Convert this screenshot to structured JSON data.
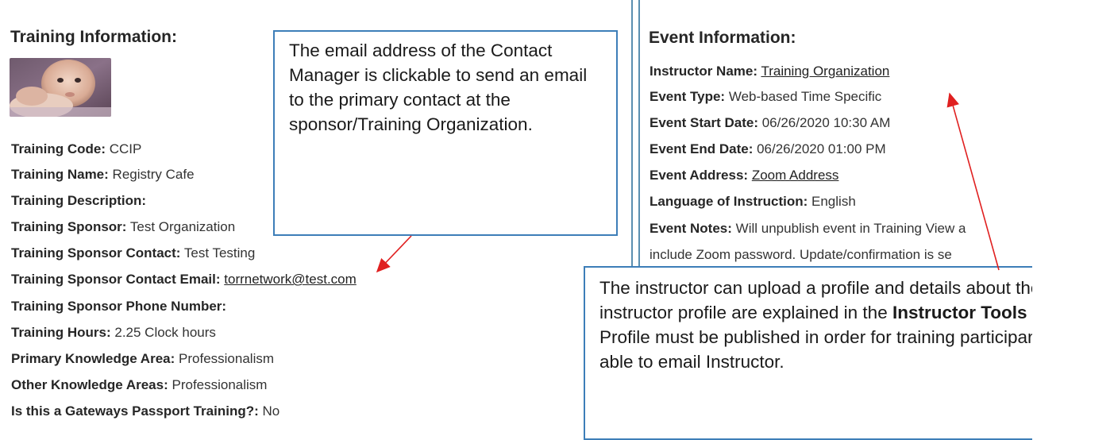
{
  "training": {
    "title": "Training Information:",
    "fields": [
      {
        "label": "Training Code:",
        "value": "CCIP"
      },
      {
        "label": "Training Name:",
        "value": "Registry Cafe"
      },
      {
        "label": "Training Description:",
        "value": ""
      },
      {
        "label": "Training Sponsor:",
        "value": "Test Organization"
      },
      {
        "label": "Training Sponsor Contact:",
        "value": "Test Testing"
      },
      {
        "label": "Training Sponsor Contact Email:",
        "value": "torrnetwork@test.com"
      },
      {
        "label": "Training Sponsor Phone Number:",
        "value": ""
      },
      {
        "label": "Training Hours:",
        "value": "2.25 Clock hours"
      },
      {
        "label": "Primary Knowledge Area:",
        "value": "Professionalism"
      },
      {
        "label": "Other Knowledge Areas:",
        "value": "Professionalism"
      },
      {
        "label": "Is this a Gateways Passport Training?:",
        "value": "No"
      }
    ]
  },
  "event": {
    "title": "Event Information:",
    "fields": [
      {
        "label": "Instructor Name:",
        "value": "Training Organization"
      },
      {
        "label": "Event Type:",
        "value": "Web-based Time Specific"
      },
      {
        "label": "Event Start Date:",
        "value": "06/26/2020 10:30 AM"
      },
      {
        "label": "Event End Date:",
        "value": "06/26/2020 01:00 PM"
      },
      {
        "label": "Event Address:",
        "value": "Zoom Address"
      },
      {
        "label": "Language of Instruction:",
        "value": "English"
      },
      {
        "label": "Event Notes:",
        "value": "Will unpublish event in Training View a"
      }
    ],
    "notes_line2": "include Zoom password. Update/confirmation is se"
  },
  "callouts": {
    "email": "The email address of the Contact Manager is clickable to send an email to the primary contact at the sponsor/Training Organization.",
    "instructor_before": "The instructor can upload a profile and details about the instructor profile are explained in the ",
    "instructor_bold": "Instructor Tools",
    "instructor_after": " section. Profile must be published in order for training participants to be able to email Instructor."
  },
  "colors": {
    "panel_border": "#5b8fb0",
    "callout_border": "#3d7eb8",
    "arrow": "#e02020"
  }
}
